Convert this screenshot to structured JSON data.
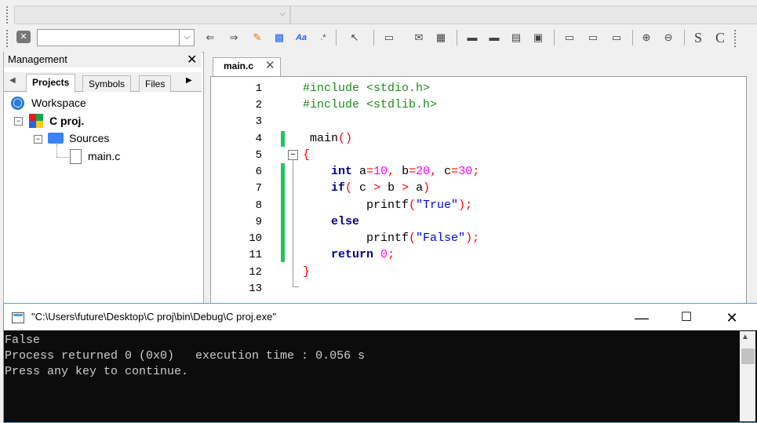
{
  "toolbar": {
    "search_value": "",
    "buttons": [
      "clear-icon",
      "back-arrow-icon",
      "forward-arrow-icon",
      "highlight-icon",
      "replace-icon",
      "match-case-icon",
      "regex-icon",
      "select-icon",
      "box-icon",
      "envelope-icon",
      "image-icon",
      "block1-icon",
      "block2-icon",
      "block3-icon",
      "block4-icon",
      "rect1-icon",
      "rect2-icon",
      "rect3-icon",
      "zoom-in-icon",
      "zoom-out-icon",
      "s-icon",
      "c-icon"
    ],
    "s_label": "S",
    "c_label": "C"
  },
  "management": {
    "title": "Management",
    "tabs": [
      "Projects",
      "Symbols",
      "Files"
    ],
    "active_tab": "Projects",
    "tree": {
      "workspace": "Workspace",
      "project": "C proj.",
      "sources": "Sources",
      "file": "main.c"
    }
  },
  "editor": {
    "tab_label": "main.c",
    "line_numbers": [
      "1",
      "2",
      "3",
      "4",
      "5",
      "6",
      "7",
      "8",
      "9",
      "10",
      "11",
      "12",
      "13"
    ]
  },
  "console": {
    "title": "\"C:\\Users\\future\\Desktop\\C proj\\bin\\Debug\\C proj.exe\"",
    "lines": [
      "False",
      "Process returned 0 (0x0)   execution time : 0.056 s",
      "Press any key to continue."
    ]
  },
  "colors": {
    "preprocessor": "#1e8a1e",
    "keyword": "#00008b",
    "number": "#ff00ff",
    "string": "#0000ff",
    "operator": "#ff0000",
    "change_marker": "#22c55e"
  }
}
